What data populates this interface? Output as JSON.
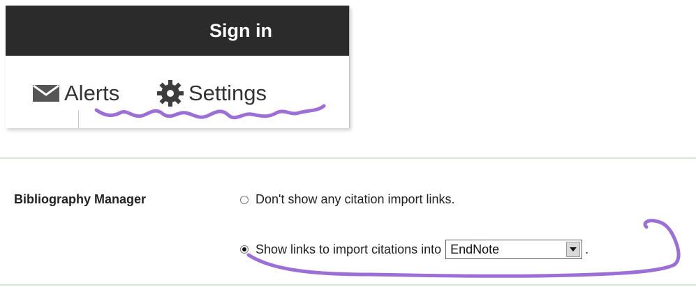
{
  "header": {
    "sign_in_label": "Sign in"
  },
  "menu": {
    "items": [
      {
        "label": "Alerts",
        "icon": "envelope-icon"
      },
      {
        "label": "Settings",
        "icon": "gear-icon"
      }
    ]
  },
  "settings": {
    "section_label": "Bibliography Manager",
    "options": [
      {
        "label": "Don't show any citation import links.",
        "checked": false
      },
      {
        "label": "Show links to import citations into",
        "checked": true
      }
    ],
    "citation_manager_select": {
      "value": "EndNote"
    },
    "trailing_text": "."
  },
  "colors": {
    "header_background": "#2b2b2b",
    "annotation_purple": "#9b6fd6",
    "divider_green": "#d3e8d3"
  }
}
